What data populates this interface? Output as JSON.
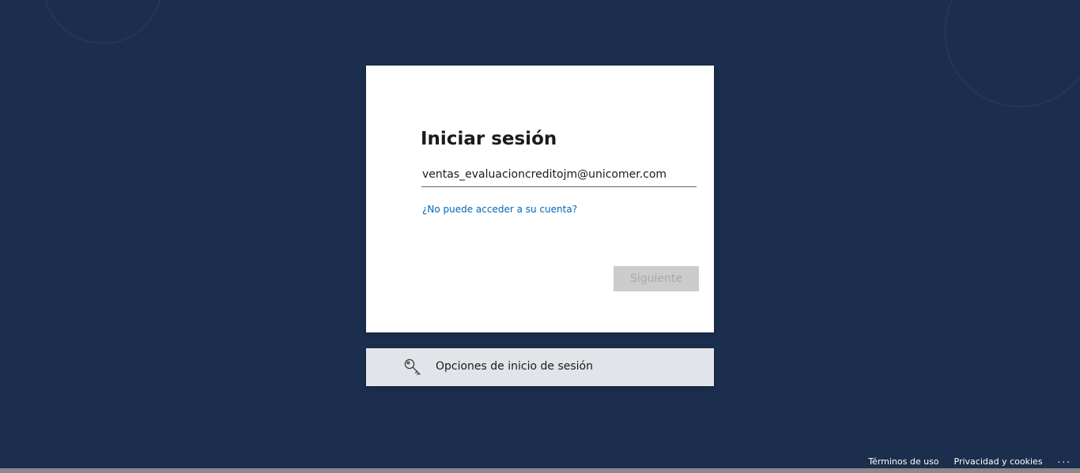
{
  "colors": {
    "background": "#1b2e4d",
    "card": "#ffffff",
    "link": "#0067b8",
    "button_disabled_bg": "#cccccc",
    "button_disabled_text": "#a8a8a8",
    "options_bar": "#e1e4e8"
  },
  "signin": {
    "title": "Iniciar sesión",
    "email_value": "ventas_evaluacioncreditojm@unicomer.com",
    "help_link": "¿No puede acceder a su cuenta?",
    "next_label": "Siguiente"
  },
  "options": {
    "icon": "key-icon",
    "label": "Opciones de inicio de sesión"
  },
  "footer": {
    "terms": "Términos de uso",
    "privacy": "Privacidad y cookies",
    "more": "..."
  }
}
